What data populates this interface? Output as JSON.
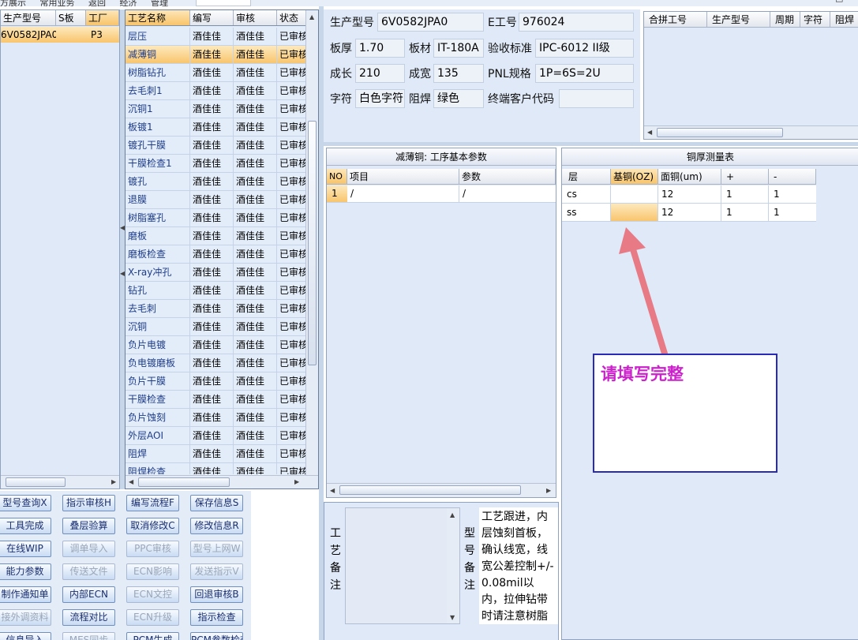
{
  "menubar": {
    "items": [
      "方展示",
      "常用业务",
      "返回",
      "经济",
      "管理"
    ],
    "window_controls": [
      "-",
      "□"
    ]
  },
  "left_grid": {
    "columns": [
      "生产型号",
      "S板",
      "工厂"
    ],
    "rows": [
      {
        "model": "6V0582JPA0",
        "sboard": "",
        "factory": "P3"
      }
    ]
  },
  "process_grid": {
    "columns": [
      "工艺名称",
      "编写",
      "审核",
      "状态"
    ],
    "rows": [
      {
        "name": "层压",
        "writer": "酒佳佳",
        "reviewer": "酒佳佳",
        "status": "已审核"
      },
      {
        "name": "减薄铜",
        "writer": "酒佳佳",
        "reviewer": "酒佳佳",
        "status": "已审核"
      },
      {
        "name": "树脂钻孔",
        "writer": "酒佳佳",
        "reviewer": "酒佳佳",
        "status": "已审核"
      },
      {
        "name": "去毛刺1",
        "writer": "酒佳佳",
        "reviewer": "酒佳佳",
        "status": "已审核"
      },
      {
        "name": "沉铜1",
        "writer": "酒佳佳",
        "reviewer": "酒佳佳",
        "status": "已审核"
      },
      {
        "name": "板镀1",
        "writer": "酒佳佳",
        "reviewer": "酒佳佳",
        "status": "已审核"
      },
      {
        "name": "镀孔干膜",
        "writer": "酒佳佳",
        "reviewer": "酒佳佳",
        "status": "已审核"
      },
      {
        "name": "干膜检查1",
        "writer": "酒佳佳",
        "reviewer": "酒佳佳",
        "status": "已审核"
      },
      {
        "name": "镀孔",
        "writer": "酒佳佳",
        "reviewer": "酒佳佳",
        "status": "已审核"
      },
      {
        "name": "退膜",
        "writer": "酒佳佳",
        "reviewer": "酒佳佳",
        "status": "已审核"
      },
      {
        "name": "树脂塞孔",
        "writer": "酒佳佳",
        "reviewer": "酒佳佳",
        "status": "已审核"
      },
      {
        "name": "磨板",
        "writer": "酒佳佳",
        "reviewer": "酒佳佳",
        "status": "已审核"
      },
      {
        "name": "磨板检查",
        "writer": "酒佳佳",
        "reviewer": "酒佳佳",
        "status": "已审核"
      },
      {
        "name": "X-ray冲孔",
        "writer": "酒佳佳",
        "reviewer": "酒佳佳",
        "status": "已审核"
      },
      {
        "name": "钻孔",
        "writer": "酒佳佳",
        "reviewer": "酒佳佳",
        "status": "已审核"
      },
      {
        "name": "去毛刺",
        "writer": "酒佳佳",
        "reviewer": "酒佳佳",
        "status": "已审核"
      },
      {
        "name": "沉铜",
        "writer": "酒佳佳",
        "reviewer": "酒佳佳",
        "status": "已审核"
      },
      {
        "name": "负片电镀",
        "writer": "酒佳佳",
        "reviewer": "酒佳佳",
        "status": "已审核"
      },
      {
        "name": "负电镀磨板",
        "writer": "酒佳佳",
        "reviewer": "酒佳佳",
        "status": "已审核"
      },
      {
        "name": "负片干膜",
        "writer": "酒佳佳",
        "reviewer": "酒佳佳",
        "status": "已审核"
      },
      {
        "name": "干膜检查",
        "writer": "酒佳佳",
        "reviewer": "酒佳佳",
        "status": "已审核"
      },
      {
        "name": "负片蚀刻",
        "writer": "酒佳佳",
        "reviewer": "酒佳佳",
        "status": "已审核"
      },
      {
        "name": "外层AOI",
        "writer": "酒佳佳",
        "reviewer": "酒佳佳",
        "status": "已审核"
      },
      {
        "name": "阻焊",
        "writer": "酒佳佳",
        "reviewer": "酒佳佳",
        "status": "已审核"
      },
      {
        "name": "阻焊检查",
        "writer": "酒佳佳",
        "reviewer": "酒佳佳",
        "status": "已审核"
      }
    ]
  },
  "info": {
    "model_label": "生产型号",
    "model_value": "6V0582JPA0",
    "e_no_label": "E工号",
    "e_no_value": "976024",
    "thickness_label": "板厚",
    "thickness_value": "1.70",
    "material_label": "板材",
    "material_value": "IT-180A",
    "standard_label": "验收标准",
    "standard_value": "IPC-6012 II级",
    "length_label": "成长",
    "length_value": "210",
    "width_label": "成宽",
    "width_value": "135",
    "pnl_label": "PNL规格",
    "pnl_value": "1P=6S=2U",
    "legend_label": "字符",
    "legend_value": "白色字符",
    "mask_label": "阻焊",
    "mask_value": "绿色",
    "customer_label": "终端客户代码",
    "customer_value": ""
  },
  "combine_grid": {
    "columns": [
      "合拼工号",
      "生产型号",
      "周期",
      "字符",
      "阻焊"
    ]
  },
  "params": {
    "title": "减薄铜: 工序基本参数",
    "columns": [
      "NO",
      "项目",
      "参数"
    ],
    "rows": [
      {
        "no": "1",
        "item": "/",
        "param": "/"
      }
    ]
  },
  "copper": {
    "title": "铜厚测量表",
    "columns": [
      "层",
      "基铜(OZ)",
      "面铜(um)",
      "+",
      "-"
    ],
    "rows": [
      {
        "layer": "cs",
        "base": "",
        "surface": "12",
        "plus": "1",
        "minus": "1"
      },
      {
        "layer": "ss",
        "base": "",
        "surface": "12",
        "plus": "1",
        "minus": "1"
      }
    ]
  },
  "callout": {
    "text": "请填写完整",
    "color": "#cc22cc",
    "arrow_color": "#e87a86"
  },
  "buttons": {
    "b1": "型号查询X",
    "b2": "指示审核H",
    "b3": "编写流程F",
    "b4": "保存信息S",
    "b5": "工具完成",
    "b6": "叠层验算",
    "b7": "取消修改C",
    "b8": "修改信息R",
    "b9": "在线WIP",
    "b10": "调单导入",
    "b11": "PPC审核",
    "b12": "型号上网W",
    "b13": "能力参数",
    "b14": "传送文件",
    "b15": "ECN影响",
    "b16": "发送指示V",
    "b17": "制作通知单",
    "b18": "内部ECN",
    "b19": "ECN文控",
    "b20": "回退审核B",
    "b21": "接外调资料",
    "b22": "流程对比",
    "b23": "ECN升级",
    "b24": "指示检查",
    "b25": "信息导入",
    "b26": "MES同步",
    "b27": "PCM生成",
    "b28": "PCM参数检查"
  },
  "notes": {
    "process_label": "工艺备注",
    "model_label": "型号备注",
    "model_text": "工艺跟进，内层蚀刻首板，确认线宽，线宽公差控制+/-0.08mil以内，拉伸钻带时请注意树脂钻孔szdrl层也一并拉伸"
  }
}
